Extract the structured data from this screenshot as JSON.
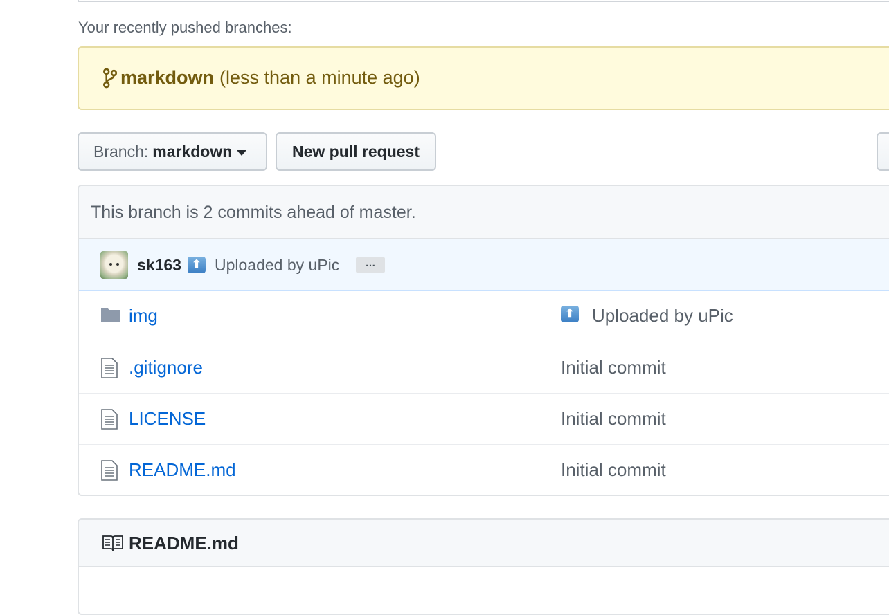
{
  "recent": {
    "label": "Your recently pushed branches:",
    "branch": "markdown",
    "time": "(less than a minute ago)"
  },
  "toolbar": {
    "branch_prefix": "Branch:",
    "branch_name": "markdown",
    "new_pr": "New pull request"
  },
  "status": {
    "ahead": "This branch is 2 commits ahead of master."
  },
  "commit": {
    "author": "sk163",
    "message": "Uploaded by uPic",
    "ellipsis": "…"
  },
  "files": [
    {
      "name": "img",
      "type": "folder",
      "commit": "Uploaded by uPic"
    },
    {
      "name": ".gitignore",
      "type": "file",
      "commit": "Initial commit"
    },
    {
      "name": "LICENSE",
      "type": "file",
      "commit": "Initial commit"
    },
    {
      "name": "README.md",
      "type": "file",
      "commit": "Initial commit"
    }
  ],
  "readme": {
    "title": "README.md"
  },
  "colors": {
    "link": "#0366d6",
    "flash_bg": "#fffbdd",
    "flash_text": "#735c0f",
    "commit_bar_bg": "#f1f8ff"
  }
}
